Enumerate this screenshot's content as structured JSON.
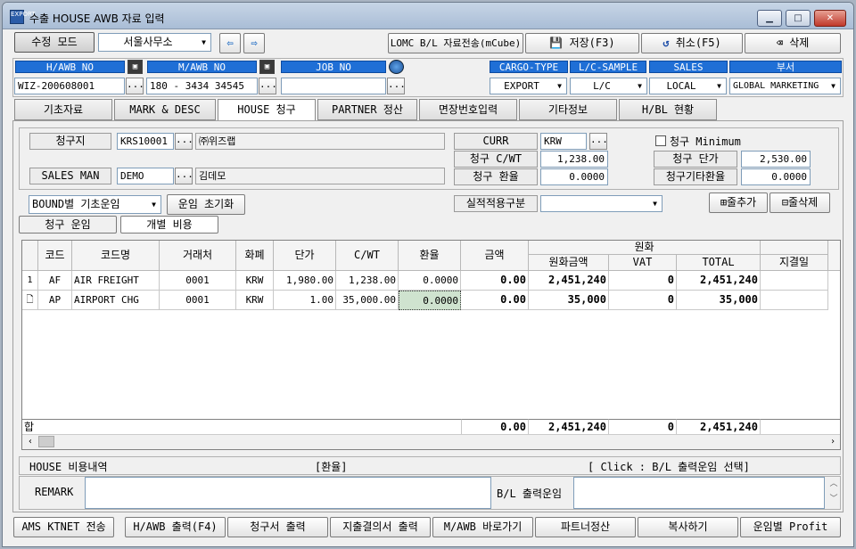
{
  "window": {
    "title": "수출 HOUSE AWB 자료 입력",
    "icon_text": "EXPORT"
  },
  "toolbar": {
    "mode_label": "수정 모드",
    "office_value": "서울사무소",
    "lomc_label": "LOMC B/L 자료전송(mCube)",
    "save_label": "저장(F3)",
    "cancel_label": "취소(F5)",
    "delete_label": "삭제"
  },
  "header_fields": {
    "hawb_label": "H/AWB NO",
    "hawb_value": "WIZ-200608001",
    "mawb_label": "M/AWB NO",
    "mawb_value": "180 - 3434 34545",
    "job_label": "JOB NO",
    "job_value": "",
    "cargo_label": "CARGO-TYPE",
    "cargo_value": "EXPORT",
    "lc_label": "L/C-SAMPLE",
    "lc_value": "L/C",
    "sales_label": "SALES",
    "sales_value": "LOCAL",
    "dept_label": "부서",
    "dept_value": "GLOBAL MARKETING"
  },
  "tabs": [
    "기초자료",
    "MARK & DESC",
    "HOUSE 청구",
    "PARTNER 정산",
    "면장번호입력",
    "기타정보",
    "H/BL 현황"
  ],
  "billing": {
    "billto_label": "청구지",
    "billto_code": "KRS10001",
    "billto_name": "㈜위즈랩",
    "salesman_label": "SALES MAN",
    "salesman_code": "DEMO",
    "salesman_name": "김데모",
    "curr_label": "CURR",
    "curr_value": "KRW",
    "cwt_label": "청구 C/WT",
    "cwt_value": "1,238.00",
    "rate_label": "청구 환율",
    "rate_value": "0.0000",
    "minimum_label": "청구 Minimum",
    "unit_label": "청구 단가",
    "unit_value": "2,530.00",
    "other_rate_label": "청구기타환율",
    "other_rate_value": "0.0000",
    "bound_value": "BOUND별 기초운임",
    "reset_label": "운임 초기화",
    "perf_label": "실적적용구분",
    "perf_value": "",
    "add_row_label": "줄추가",
    "del_row_label": "줄삭제"
  },
  "subtabs": [
    "청구 운임",
    "개별 비용"
  ],
  "grid": {
    "group_header": "원화",
    "headers": [
      "코드",
      "코드명",
      "거래처",
      "화폐",
      "단가",
      "C/WT",
      "환율",
      "금액",
      "원화금액",
      "VAT",
      "TOTAL",
      "지결일"
    ],
    "rows": [
      {
        "no": "1",
        "code": "AF",
        "name": "AIR FREIGHT",
        "vendor": "0001",
        "cur": "KRW",
        "price": "1,980.00",
        "cwt": "1,238.00",
        "rate": "0.0000",
        "amount": "0.00",
        "krw": "2,451,240",
        "vat": "0",
        "total": "2,451,240",
        "date": ""
      },
      {
        "no": "",
        "code": "AP",
        "name": "AIRPORT CHG",
        "vendor": "0001",
        "cur": "KRW",
        "price": "1.00",
        "cwt": "35,000.00",
        "rate": "0.0000",
        "amount": "0.00",
        "krw": "35,000",
        "vat": "0",
        "total": "35,000",
        "date": ""
      }
    ],
    "sum_label": "합",
    "sum": {
      "amount": "0.00",
      "krw": "2,451,240",
      "vat": "0",
      "total": "2,451,240"
    }
  },
  "footer_info": {
    "left": "HOUSE 비용내역",
    "mid": "[환율]",
    "right": "[ Click : B/L 출력운임 선택]"
  },
  "remark": {
    "label": "REMARK",
    "value": "",
    "bl_label": "B/L 출력운임",
    "bl_value": ""
  },
  "bottom_buttons": [
    "AMS KTNET 전송",
    "H/AWB 출력(F4)",
    "청구서 출력",
    "지출결의서 출력",
    "M/AWB 바로가기",
    "파트너정산",
    "복사하기",
    "운임별 Profit"
  ],
  "colors": {
    "header_blue": "#1f6fd6",
    "selected_cell": "#cfe3cf"
  }
}
